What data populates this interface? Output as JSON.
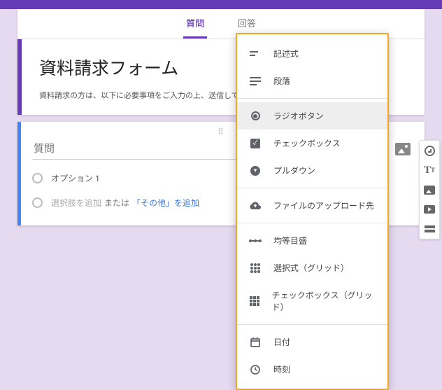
{
  "tabs": {
    "questions": "質問",
    "responses": "回答"
  },
  "form": {
    "title": "資料請求フォーム",
    "description": "資料請求の方は、以下に必要事項をご入力の上、送信してください。"
  },
  "question": {
    "placeholder": "質問",
    "option1": "オプション 1",
    "add_option": "選択肢を追加",
    "or": "または",
    "add_other": "「その他」を追加"
  },
  "menu": {
    "short_answer": "記述式",
    "paragraph": "段落",
    "radio": "ラジオボタン",
    "checkbox": "チェックボックス",
    "dropdown": "プルダウン",
    "file_upload": "ファイルのアップロード先",
    "linear": "均等目盛",
    "grid_mc": "選択式（グリッド）",
    "grid_cb": "チェックボックス（グリッド）",
    "date": "日付",
    "time": "時刻"
  }
}
